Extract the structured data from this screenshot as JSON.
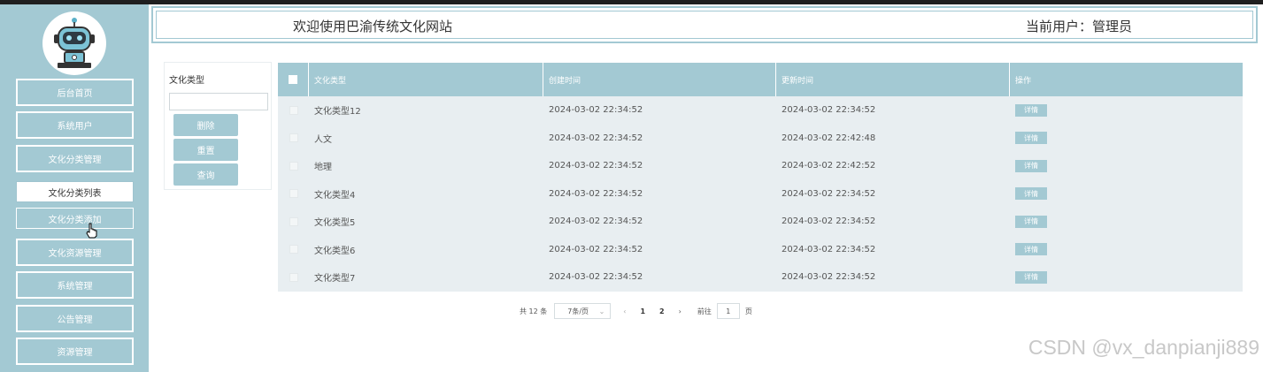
{
  "header": {
    "site_title": "欢迎使用巴渝传统文化网站",
    "current_user": "当前用户：管理员"
  },
  "sidebar": {
    "items": [
      {
        "label": "后台首页"
      },
      {
        "label": "系统用户"
      },
      {
        "label": "文化分类管理"
      },
      {
        "label": "文化分类列表"
      },
      {
        "label": "文化分类添加"
      },
      {
        "label": "文化资源管理"
      },
      {
        "label": "系统管理"
      },
      {
        "label": "公告管理"
      },
      {
        "label": "资源管理"
      }
    ]
  },
  "filter": {
    "label": "文化类型",
    "input_value": "",
    "delete_label": "删除",
    "reset_label": "重置",
    "search_label": "查询"
  },
  "table": {
    "headers": [
      "文化类型",
      "创建时间",
      "更新时间",
      "操作"
    ],
    "rows": [
      {
        "type": "文化类型12",
        "created": "2024-03-02 22:34:52",
        "updated": "2024-03-02 22:34:52",
        "action": "详情"
      },
      {
        "type": "人文",
        "created": "2024-03-02 22:34:52",
        "updated": "2024-03-02 22:42:48",
        "action": "详情"
      },
      {
        "type": "地理",
        "created": "2024-03-02 22:34:52",
        "updated": "2024-03-02 22:42:52",
        "action": "详情"
      },
      {
        "type": "文化类型4",
        "created": "2024-03-02 22:34:52",
        "updated": "2024-03-02 22:34:52",
        "action": "详情"
      },
      {
        "type": "文化类型5",
        "created": "2024-03-02 22:34:52",
        "updated": "2024-03-02 22:34:52",
        "action": "详情"
      },
      {
        "type": "文化类型6",
        "created": "2024-03-02 22:34:52",
        "updated": "2024-03-02 22:34:52",
        "action": "详情"
      },
      {
        "type": "文化类型7",
        "created": "2024-03-02 22:34:52",
        "updated": "2024-03-02 22:34:52",
        "action": "详情"
      }
    ]
  },
  "pagination": {
    "total": "共 12 条",
    "page_size": "7条/页",
    "prev": "‹",
    "page1": "1",
    "page2": "2",
    "next": "›",
    "goto_label": "前往",
    "goto_value": "1",
    "page_unit": "页"
  },
  "watermark": "CSDN @vx_danpianji889",
  "colors": {
    "accent": "#a3c9d3",
    "row_bg": "#e8eef1"
  }
}
